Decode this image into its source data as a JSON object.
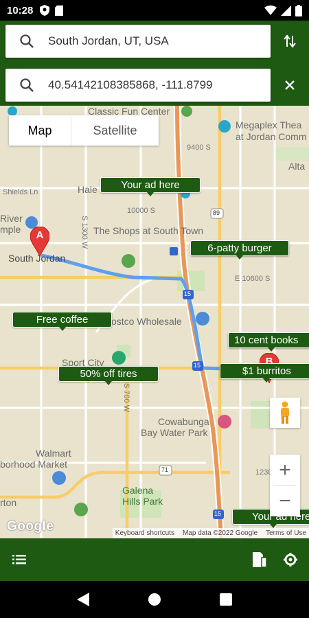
{
  "status_bar": {
    "time": "10:28",
    "icons": [
      "shield-icon",
      "sd-card-icon",
      "wifi-icon",
      "signal-icon",
      "battery-icon"
    ]
  },
  "search": {
    "origin_value": "South Jordan, UT, USA",
    "destination_value": "40.54142108385868, -111.8799",
    "swap_icon": "swap-vertical-icon",
    "clear_icon": "close-icon"
  },
  "map": {
    "type_control": {
      "map_label": "Map",
      "satellite_label": "Satellite",
      "selected": "Map"
    },
    "labels": {
      "classic_fun_center": "Classic Fun Center",
      "megaplex_line1": "Megaplex Thea",
      "megaplex_line2": "at Jordan Comm",
      "alta": "Alta",
      "s9400": "9400 S",
      "shields": "Shields Ln",
      "hale": "Hale",
      "s10000": "10000 S",
      "river_line1": "River",
      "river_line2": "mple",
      "south_jordan": "South Jordan",
      "shops": "The Shops at South Town",
      "s1300": "S 1300 W",
      "e10600": "E 10600 S",
      "costco": "ostco Wholesale",
      "sport_city": "Sport City",
      "s700": "S 700 W",
      "cowabunga_line1": "Cowabunga",
      "cowabunga_line2": "Bay Water Park",
      "walmart_line1": "Walmart",
      "walmart_line2": "borhood Market",
      "galena_line1": "Galena",
      "galena_line2": "Hills Park",
      "orton": "rton",
      "s12300": "1230",
      "route_89": "89",
      "route_15a": "15",
      "route_15b": "15",
      "route_15c": "15",
      "route_71": "71",
      "route_71b": "71"
    },
    "markers": {
      "a": "A",
      "b": "B"
    },
    "ads": {
      "ad1": "Your ad here",
      "ad2": "6-patty burger",
      "ad3": "Free coffee",
      "ad4": "10 cent books",
      "ad5": "50% off tires",
      "ad6": "$1 burritos",
      "ad7": "Your ad here"
    },
    "zoom_in": "+",
    "zoom_out": "−",
    "google_logo": "Google",
    "attribution": {
      "shortcuts": "Keyboard shortcuts",
      "data": "Map data ©2022 Google",
      "terms": "Terms of Use"
    },
    "colors": {
      "route": "#6ca5f0",
      "highway": "#e89758",
      "ad_bg": "#1e5a12",
      "marker": "#e53935"
    }
  },
  "bottom_bar": {
    "list_icon": "list-icon",
    "sim_icon": "sim-card-icon",
    "settings_icon": "settings-icon"
  },
  "nav_bar": {
    "back_icon": "back-triangle-icon",
    "home_icon": "home-circle-icon",
    "recents_icon": "recents-square-icon"
  }
}
